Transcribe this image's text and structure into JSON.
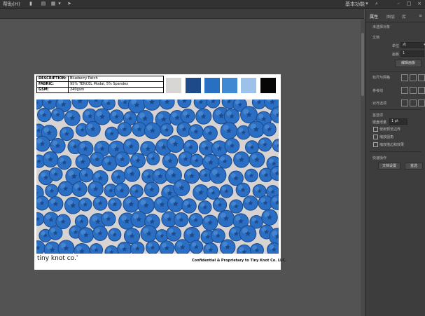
{
  "menubar": {
    "help_menu": "帮助(H)",
    "workspace": "基本功能"
  },
  "panel": {
    "tabs": [
      "属性",
      "图层",
      "库"
    ],
    "no_selection": "未选择对象",
    "doc_label": "文档",
    "units_label": "单位",
    "units_value": "点",
    "artboard_label": "画板",
    "artboard_value": "1",
    "edit_artboard_button": "编辑画板",
    "rulers_grids": "标尺与网格",
    "guides": "参考线",
    "snap": "对齐选项",
    "preferences": "首选项",
    "keyboard_increment_label": "键盘增量",
    "keyboard_increment_value": "1 pt",
    "options": [
      "使用预览边界",
      "缩放圆角",
      "缩放描边和效果"
    ],
    "quick_actions": "快速操作",
    "document_setup_button": "文档设置",
    "preferences_button": "首选"
  },
  "artboard": {
    "spec_rows": [
      {
        "key": "DESCRIPTION:",
        "value": "Blueberry Patch"
      },
      {
        "key": "FABRIC:",
        "value": "95% TENCEL Modal, 5% Spandex"
      },
      {
        "key": "GSM:",
        "value": "240gsm"
      }
    ],
    "swatches": [
      "#d8d6d5",
      "#1f4a8a",
      "#2a70c2",
      "#4189d2",
      "#9cc2ea",
      "#060606"
    ],
    "brand": "tiny knot co.",
    "confidential": "Confidential & Proprietary to Tiny Knot Co. LLC."
  },
  "colors": {
    "berry": "#2b6fc4",
    "berry_dark": "#1b4a8c",
    "berry_light": "#5795d8",
    "pattern_bg": "#d6d3d2"
  }
}
